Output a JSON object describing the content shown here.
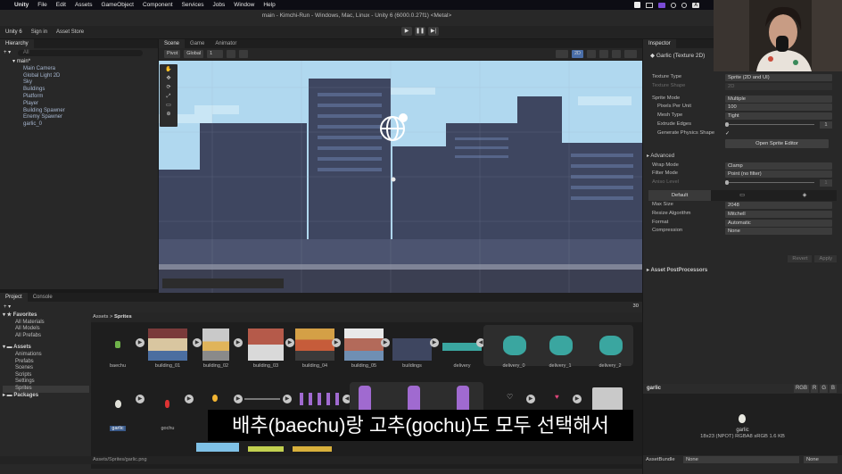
{
  "menubar": {
    "items": [
      "Unity",
      "File",
      "Edit",
      "Assets",
      "GameObject",
      "Component",
      "Services",
      "Jobs",
      "Window",
      "Help"
    ],
    "status": [
      "A"
    ]
  },
  "window": {
    "title": "main - Kimchi-Run - Windows, Mac, Linux - Unity 6 (6000.0.27f1) <Metal>"
  },
  "toolbar": {
    "account": "Unity 6",
    "sign_in": "Sign in",
    "asset_store": "Asset Store"
  },
  "hierarchy": {
    "tab": "Hierarchy",
    "search_placeholder": "All",
    "scene": "main*",
    "children": [
      "Main Camera",
      "Global Light 2D",
      "Sky",
      "Buildings",
      "Platform",
      "Player",
      "Building Spawner",
      "Enemy Spawner",
      "garlic_0"
    ]
  },
  "scene_view": {
    "tabs": [
      "Scene",
      "Game",
      "Animator"
    ],
    "pivot": "Pivot",
    "global": "Global",
    "grid_value": "1",
    "mode_2d": "2D"
  },
  "inspector": {
    "tab": "Inspector",
    "asset_name": "Garlic (Texture 2D)",
    "rows": [
      {
        "label": "Texture Type",
        "value": "Sprite (2D and UI)",
        "disabled": false
      },
      {
        "label": "Texture Shape",
        "value": "2D",
        "disabled": true
      },
      {
        "label": "Sprite Mode",
        "value": "Multiple",
        "disabled": false
      },
      {
        "label": "Pixels Per Unit",
        "value": "100",
        "disabled": false
      },
      {
        "label": "Mesh Type",
        "value": "Tight",
        "disabled": false
      },
      {
        "label": "Extrude Edges",
        "value": "1",
        "disabled": false
      },
      {
        "label": "Generate Physics Shape",
        "value": "✓",
        "disabled": false
      }
    ],
    "open_sprite_editor": "Open Sprite Editor",
    "advanced": "Advanced",
    "wrap_mode_label": "Wrap Mode",
    "wrap_mode": "Clamp",
    "filter_mode_label": "Filter Mode",
    "filter_mode": "Point (no filter)",
    "aniso_label": "Aniso Level",
    "aniso_value": "1",
    "platform_default": "Default",
    "max_size_label": "Max Size",
    "max_size": "2048",
    "resize_label": "Resize Algorithm",
    "resize": "Mitchell",
    "format_label": "Format",
    "format": "Automatic",
    "compression_label": "Compression",
    "compression": "None",
    "revert": "Revert",
    "apply": "Apply",
    "postprocessors": "Asset PostProcessors",
    "preview_title": "garlic",
    "channels": [
      "RGB",
      "R",
      "G",
      "B"
    ],
    "preview_name": "garlic",
    "preview_info": "18x23 (NPOT)  RGBA8 sRGB  1.6 KB",
    "assetbundle_label": "AssetBundle",
    "assetbundle": "None",
    "assetbundle_variant": "None"
  },
  "project": {
    "tabs": [
      "Project",
      "Console"
    ],
    "favorites": "Favorites",
    "fav_items": [
      "All Materials",
      "All Models",
      "All Prefabs"
    ],
    "assets": "Assets",
    "folders": [
      "Animations",
      "Prefabs",
      "Scenes",
      "Scripts",
      "Settings",
      "Sprites"
    ],
    "packages": "Packages",
    "breadcrumb": [
      "Assets",
      "Sprites"
    ],
    "count": "30",
    "row1": [
      "baechu",
      "building_01",
      "building_02",
      "building_03",
      "building_04",
      "building_05",
      "buildings",
      "delivery",
      "delivery_0",
      "delivery_1",
      "delivery_2"
    ],
    "row2": [
      "garlic",
      "gochu"
    ],
    "status_path": "Assets/Sprites/garlic.png"
  },
  "subtitle": "배추(baechu)랑 고추(gochu)도 모두 선택해서",
  "colors": {
    "sky": "#b0d8ef",
    "building": "#3e4660",
    "window": "#5a6a90",
    "accent_teal": "#3aa6a0",
    "ui_bg": "#282828"
  }
}
